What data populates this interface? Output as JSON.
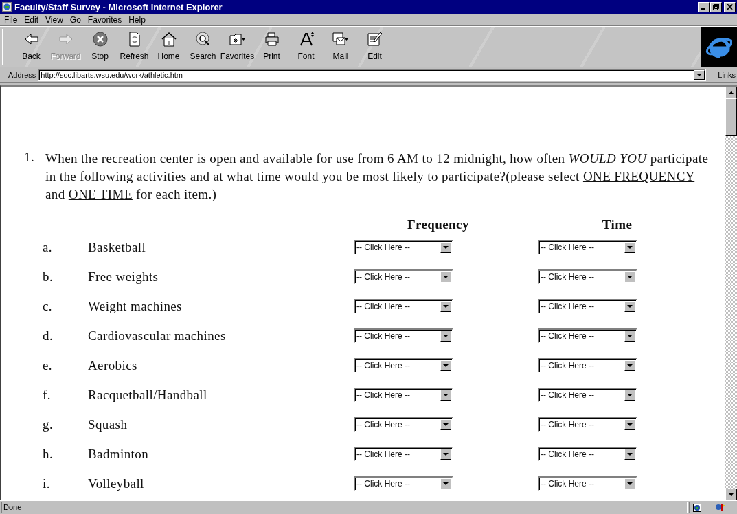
{
  "window": {
    "title": "Faculty/Staff Survey - Microsoft Internet Explorer"
  },
  "menu": [
    "File",
    "Edit",
    "View",
    "Go",
    "Favorites",
    "Help"
  ],
  "toolbar": [
    {
      "label": "Back",
      "kind": "back",
      "disabled": false,
      "dropdown": false
    },
    {
      "label": "Forward",
      "kind": "forward",
      "disabled": true,
      "dropdown": false
    },
    {
      "label": "Stop",
      "kind": "stop",
      "disabled": false,
      "dropdown": false
    },
    {
      "label": "Refresh",
      "kind": "refresh",
      "disabled": false,
      "dropdown": false
    },
    {
      "label": "Home",
      "kind": "home",
      "disabled": false,
      "dropdown": false
    },
    {
      "label": "Search",
      "kind": "search",
      "disabled": false,
      "dropdown": false
    },
    {
      "label": "Favorites",
      "kind": "favorites",
      "disabled": false,
      "dropdown": true
    },
    {
      "label": "Print",
      "kind": "print",
      "disabled": false,
      "dropdown": false
    },
    {
      "label": "Font",
      "kind": "font",
      "disabled": false,
      "dropdown": false
    },
    {
      "label": "Mail",
      "kind": "mail",
      "disabled": false,
      "dropdown": true
    },
    {
      "label": "Edit",
      "kind": "edit",
      "disabled": false,
      "dropdown": false
    }
  ],
  "address": {
    "label": "Address",
    "value": "http://soc.libarts.wsu.edu/work/athletic.htm",
    "links": "Links"
  },
  "question": {
    "number": "1.",
    "parts": [
      {
        "text": "When the recreation center is open and available for use from 6 AM to 12 midnight, how often ",
        "kind": "plain"
      },
      {
        "text": "WOULD YOU",
        "kind": "emphasis"
      },
      {
        "text": " participate in the following activities and at what time would you be most likely to participate?(please select ",
        "kind": "plain"
      },
      {
        "text": "ONE FREQUENCY",
        "kind": "keyword"
      },
      {
        "text": " and ",
        "kind": "plain"
      },
      {
        "text": "ONE TIME",
        "kind": "keyword"
      },
      {
        "text": " for each item.)",
        "kind": "plain"
      }
    ]
  },
  "columns": [
    "Frequency",
    "Time"
  ],
  "items": [
    {
      "letter": "a.",
      "activity": "Basketball",
      "frequency": "-- Click Here --",
      "time": "-- Click Here --"
    },
    {
      "letter": "b.",
      "activity": "Free weights",
      "frequency": "-- Click Here --",
      "time": "-- Click Here --"
    },
    {
      "letter": "c.",
      "activity": "Weight machines",
      "frequency": "-- Click Here --",
      "time": "-- Click Here --"
    },
    {
      "letter": "d.",
      "activity": "Cardiovascular machines",
      "frequency": "-- Click Here --",
      "time": "-- Click Here --"
    },
    {
      "letter": "e.",
      "activity": "Aerobics",
      "frequency": "-- Click Here --",
      "time": "-- Click Here --"
    },
    {
      "letter": "f.",
      "activity": "Racquetball/Handball",
      "frequency": "-- Click Here --",
      "time": "-- Click Here --"
    },
    {
      "letter": "g.",
      "activity": "Squash",
      "frequency": "-- Click Here --",
      "time": "-- Click Here --"
    },
    {
      "letter": "h.",
      "activity": "Badminton",
      "frequency": "-- Click Here --",
      "time": "-- Click Here --"
    },
    {
      "letter": "i.",
      "activity": "Volleyball",
      "frequency": "-- Click Here --",
      "time": "-- Click Here --"
    }
  ],
  "status_bar": {
    "text": "Done"
  }
}
